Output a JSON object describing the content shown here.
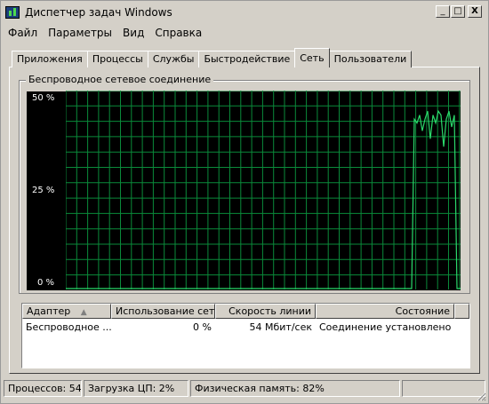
{
  "window": {
    "title": "Диспетчер задач Windows",
    "icon": "taskmgr-icon",
    "minimize_glyph": "_",
    "maximize_glyph": "□",
    "close_glyph": "X"
  },
  "menu": [
    "Файл",
    "Параметры",
    "Вид",
    "Справка"
  ],
  "tabs": [
    {
      "label": "Приложения",
      "active": false
    },
    {
      "label": "Процессы",
      "active": false
    },
    {
      "label": "Службы",
      "active": false
    },
    {
      "label": "Быстродействие",
      "active": false
    },
    {
      "label": "Сеть",
      "active": true
    },
    {
      "label": "Пользователи",
      "active": false
    }
  ],
  "network_graph": {
    "title": "Беспроводное сетевое соединение",
    "y_labels": [
      "50 %",
      "25 %",
      "0 %"
    ],
    "ylim": [
      0,
      50
    ],
    "grid": true,
    "line_color": "#2bd96b",
    "grid_color": "#0a8a3a",
    "background": "#000000"
  },
  "adapters_table": {
    "columns": [
      "Адаптер",
      "Использование сети",
      "Скорость линии",
      "Состояние"
    ],
    "sort_indicator": "▲",
    "rows": [
      {
        "adapter": "Беспроводное ...",
        "usage": "0 %",
        "speed": "54 Мбит/сек",
        "state": "Соединение установлено"
      }
    ]
  },
  "status_bar": {
    "processes": "Процессов: 54",
    "cpu": "Загрузка ЦП: 2%",
    "memory": "Физическая память: 82%"
  }
}
